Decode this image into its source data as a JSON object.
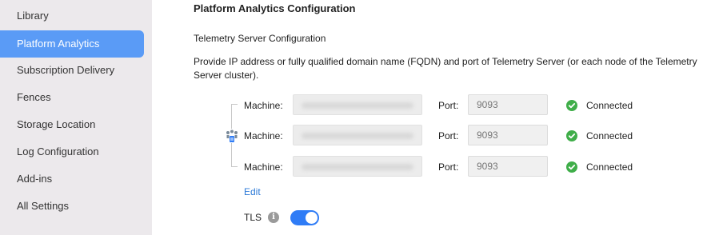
{
  "sidebar": {
    "items": [
      {
        "label": "Library"
      },
      {
        "label": "Platform Analytics",
        "active": true
      },
      {
        "label": "Subscription Delivery"
      },
      {
        "label": "Fences"
      },
      {
        "label": "Storage Location"
      },
      {
        "label": "Log Configuration"
      },
      {
        "label": "Add-ins"
      },
      {
        "label": "All Settings"
      }
    ]
  },
  "main": {
    "title": "Platform Analytics Configuration",
    "section_title": "Telemetry Server Configuration",
    "description": "Provide IP address or fully qualified domain name (FQDN) and port of Telemetry Server (or each node of the Telemetry Server cluster).",
    "machine_label": "Machine:",
    "port_label": "Port:",
    "rows": [
      {
        "port": "9093",
        "status": "Connected"
      },
      {
        "port": "9093",
        "status": "Connected"
      },
      {
        "port": "9093",
        "status": "Connected"
      }
    ],
    "edit_label": "Edit",
    "tls_label": "TLS",
    "tls_enabled": true
  },
  "colors": {
    "accent": "#5a9bf6",
    "toggle": "#2f7cf6",
    "success": "#3fae49",
    "link": "#2e7bd8",
    "sidebar_bg": "#ece9ec"
  },
  "icons": {
    "cluster": "cluster-nodes-icon",
    "status": "check-circle-icon",
    "info": "info-icon"
  }
}
